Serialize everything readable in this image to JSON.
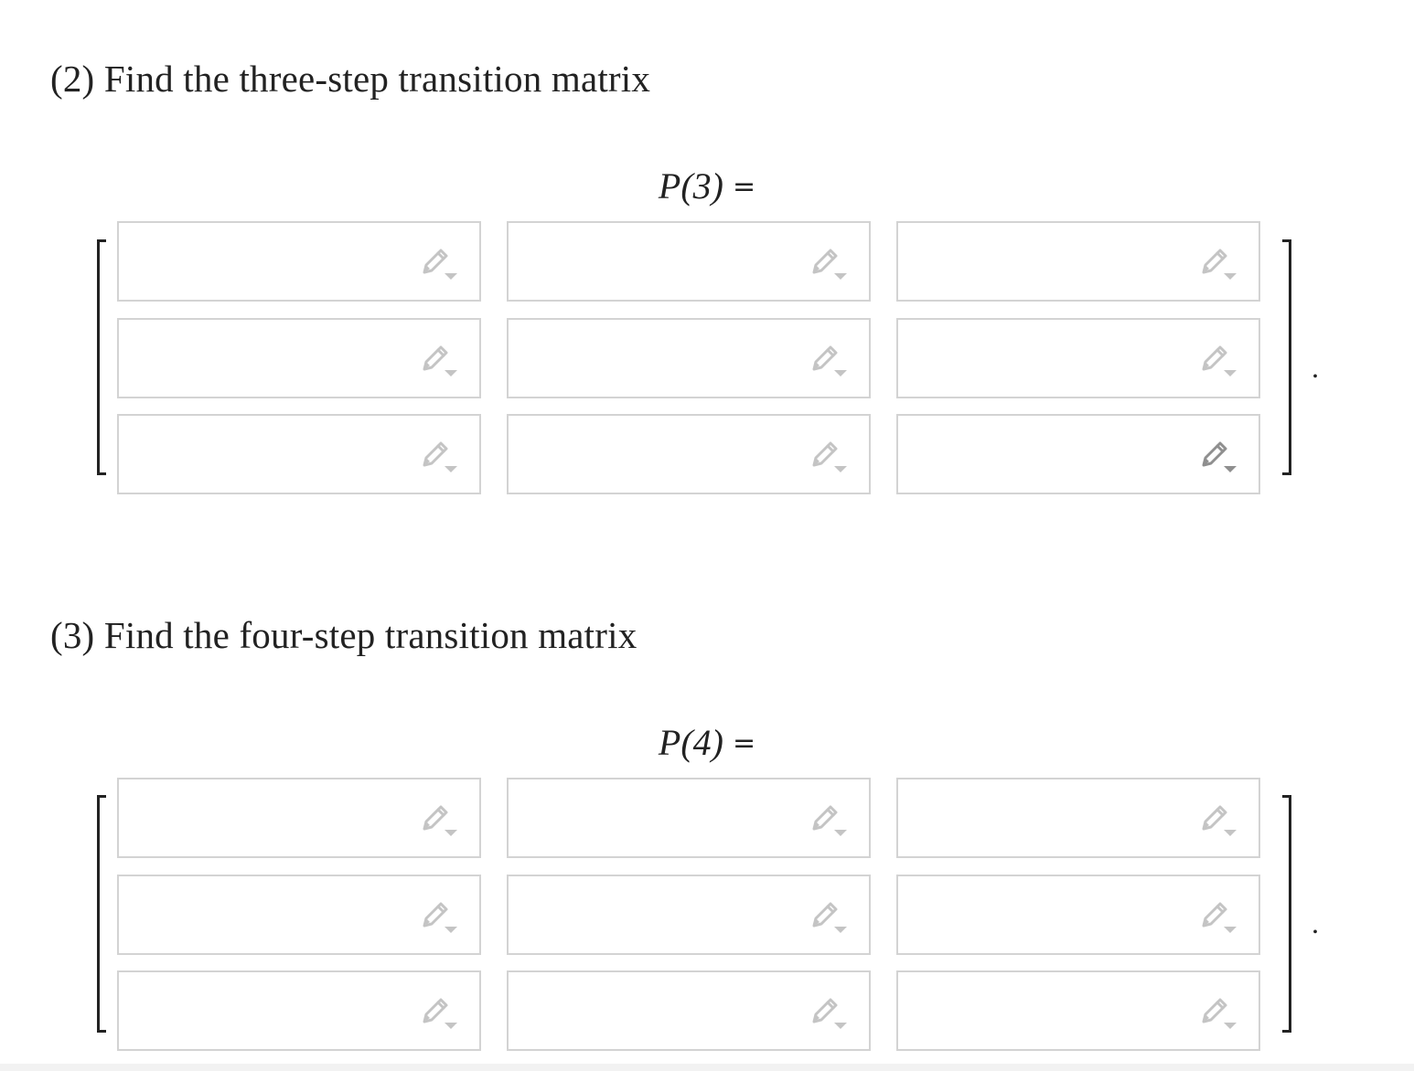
{
  "sections": [
    {
      "question": "(2) Find the three-step transition matrix",
      "matrix_symbol": "P(3)",
      "equals": "=",
      "trailing_punctuation": ".",
      "cells": [
        {
          "value": "",
          "icon": "pencil-dropdown-icon",
          "icon_state": "inactive"
        },
        {
          "value": "",
          "icon": "pencil-dropdown-icon",
          "icon_state": "inactive"
        },
        {
          "value": "",
          "icon": "pencil-dropdown-icon",
          "icon_state": "inactive"
        },
        {
          "value": "",
          "icon": "pencil-dropdown-icon",
          "icon_state": "inactive"
        },
        {
          "value": "",
          "icon": "pencil-dropdown-icon",
          "icon_state": "inactive"
        },
        {
          "value": "",
          "icon": "pencil-dropdown-icon",
          "icon_state": "inactive"
        },
        {
          "value": "",
          "icon": "pencil-dropdown-icon",
          "icon_state": "inactive"
        },
        {
          "value": "",
          "icon": "pencil-dropdown-icon",
          "icon_state": "inactive"
        },
        {
          "value": "",
          "icon": "pencil-dropdown-icon",
          "icon_state": "hover"
        }
      ]
    },
    {
      "question": "(3) Find the four-step transition matrix",
      "matrix_symbol": "P(4)",
      "equals": "=",
      "trailing_punctuation": ".",
      "cells": [
        {
          "value": "",
          "icon": "pencil-dropdown-icon",
          "icon_state": "inactive"
        },
        {
          "value": "",
          "icon": "pencil-dropdown-icon",
          "icon_state": "inactive"
        },
        {
          "value": "",
          "icon": "pencil-dropdown-icon",
          "icon_state": "inactive"
        },
        {
          "value": "",
          "icon": "pencil-dropdown-icon",
          "icon_state": "inactive"
        },
        {
          "value": "",
          "icon": "pencil-dropdown-icon",
          "icon_state": "inactive"
        },
        {
          "value": "",
          "icon": "pencil-dropdown-icon",
          "icon_state": "inactive"
        },
        {
          "value": "",
          "icon": "pencil-dropdown-icon",
          "icon_state": "inactive"
        },
        {
          "value": "",
          "icon": "pencil-dropdown-icon",
          "icon_state": "inactive"
        },
        {
          "value": "",
          "icon": "pencil-dropdown-icon",
          "icon_state": "inactive"
        }
      ]
    }
  ],
  "colors": {
    "cell_border": "#d3d3d3",
    "icon_inactive": "#c4c4c4",
    "icon_hover": "#8f8f8f",
    "text": "#222222"
  }
}
